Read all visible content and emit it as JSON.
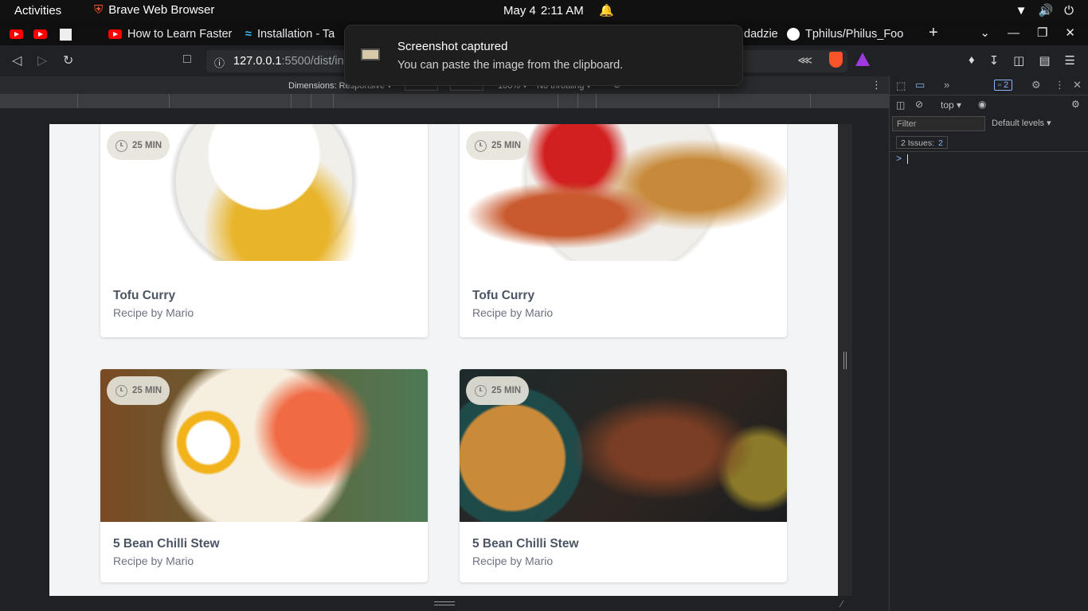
{
  "topbar": {
    "activities": "Activities",
    "app_name": "Brave Web Browser",
    "date": "May 4",
    "time": "2:11 AM"
  },
  "tabs": [
    {
      "label": "How to Learn Faster",
      "icon": "youtube-icon"
    },
    {
      "label": "Installation - Ta",
      "icon": "tailwind-icon"
    },
    {
      "label": "dadzie",
      "icon": "page-icon"
    },
    {
      "label": "Tphilus/Philus_Foo",
      "icon": "github-icon"
    }
  ],
  "address": {
    "host": "127.0.0.1",
    "path": ":5500/dist/in"
  },
  "notification": {
    "title": "Screenshot captured",
    "body": "You can paste the image from the clipboard."
  },
  "device_toolbar": {
    "dimensions": "Dimensions: Responsive",
    "width": "990",
    "zoom": "100%",
    "throttle": "No throttling"
  },
  "cards": [
    {
      "time": "25 MIN",
      "title": "Tofu Curry",
      "subtitle": "Recipe by Mario"
    },
    {
      "time": "25 MIN",
      "title": "Tofu Curry",
      "subtitle": "Recipe by Mario"
    },
    {
      "time": "25 MIN",
      "title": "5 Bean Chilli Stew",
      "subtitle": "Recipe by Mario"
    },
    {
      "time": "25 MIN",
      "title": "5 Bean Chilli Stew",
      "subtitle": "Recipe by Mario"
    }
  ],
  "devtools": {
    "issues_badge": "2",
    "context": "top",
    "filter_placeholder": "Filter",
    "levels": "Default levels",
    "issues_label": "2 Issues:",
    "issues_count": "2",
    "prompt": ">"
  }
}
